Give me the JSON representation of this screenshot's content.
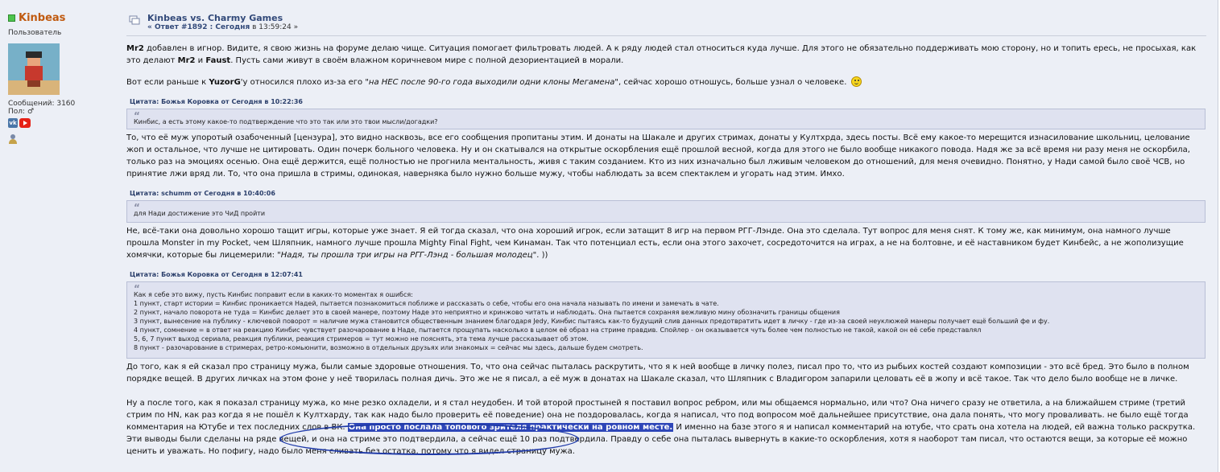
{
  "user": {
    "name": "Kinbeas",
    "title": "Пользователь",
    "posts_label": "Сообщений: 3160",
    "gender_label": "Пол:",
    "gender_symbol": "♂",
    "vk_label": "vk",
    "online_color": "#4ec44e"
  },
  "post": {
    "title": "Kinbeas vs. Charmy Games",
    "reply_prefix": "« Ответ #1892 : Сегодня",
    "reply_time": " в 13:59:24 »",
    "para1": [
      {
        "t": "Mr2",
        "b": true
      },
      {
        "t": " добавлен в игнор. Видите, я свою жизнь на форуме делаю чище. Ситуация помогает фильтровать людей. А к ряду людей стал относиться куда лучше. Для этого не обязательно поддерживать мою сторону, но и топить ересь, не просыхая, как это делают "
      },
      {
        "t": "Mr2",
        "b": true
      },
      {
        "t": " и "
      },
      {
        "t": "Faust",
        "b": true
      },
      {
        "t": ". Пусть сами живут в своём влажном коричневом мире с полной дезориентацией в морали."
      }
    ],
    "para2": [
      {
        "t": "Вот если раньше к "
      },
      {
        "t": "YuzorG",
        "b": true
      },
      {
        "t": "'у относился плохо из-за его \""
      },
      {
        "t": "на НЕС после 90-го года выходили одни клоны Мегамена",
        "i": true
      },
      {
        "t": "\", сейчас хорошо отношусь, больше узнал о человеке."
      }
    ],
    "quote1": {
      "head": "Цитата: Божья Коровка от Сегодня в 10:22:36",
      "lines": [
        "Кинбис, а есть этому какое-то подтверждение что это так или это твои мысли/догадки?"
      ]
    },
    "para3": "То, что её муж упоротый озабоченный [цензура], это видно насквозь, все его сообщения пропитаны этим. И донаты на Шакале и других стримах, донаты у Култхрда, здесь посты. Всё ему какое-то мерещится изнасилование школьниц, целование жоп и остальное, что лучше не цитировать. Один почерк больного человека. Ну и он скатывался на открытые оскорбления ещё прошлой весной, когда для этого не было вообще никакого повода. Надя же за всё время ни разу меня не оскорбила, только раз на эмоциях осенью. Она ещё держится, ещё полностью не прогнила ментальность, живя с таким созданием. Кто из них изначально был лживым человеком до отношений, для меня очевидно. Понятно, у Нади самой было своё ЧСВ, но принятие лжи вряд ли. То, что она пришла в стримы, одинокая, наверняка было нужно больше мужу, чтобы наблюдать за всем спектаклем и угорать над этим. Имхо.",
    "quote2": {
      "head": "Цитата: schumm от Сегодня в 10:40:06",
      "lines": [
        "для Нади достижение это ЧиД пройти"
      ]
    },
    "para4": [
      {
        "t": "Не, всё-таки она довольно хорошо тащит игры, которые уже знает. Я ей тогда сказал, что она хороший игрок, если затащит 8 игр на первом РГГ-Лэнде. Она это сделала. Тут вопрос для меня снят. К тому же, как минимум, она намного лучше прошла Monster in my Pocket, чем Шляпник, намного лучше прошла Mighty Final Fight, чем Кинаман. Так что потенциал есть, если она этого захочет, сосредоточится на играх, а не на болтовне, и её наставником будет Кинбейс, а не жополизущие хомячки, которые бы лицемерили: \""
      },
      {
        "t": "Надя, ты прошла три игры на РГГ-Лэнд - большая молодец",
        "i": true
      },
      {
        "t": "\". ))"
      }
    ],
    "quote3": {
      "head": "Цитата: Божья Коровка от Сегодня в 12:07:41",
      "lines": [
        "Как я себе это вижу, пусть Кинбис поправит если в каких-то моментах я ошибся:",
        "1 пункт, старт истории = Кинбис проникается Надей, пытается познакомиться поближе и рассказать о себе, чтобы его она начала называть по имени и замечать в чате.",
        "2 пункт, начало поворота не туда = Кинбис делает это в своей манере, поэтому Наде это неприятно и кринжово читать и наблюдать. Она пытается сохраняя вежливую мину обозначить границы общения",
        "3 пункт, вынесение на публику - ключевой поворот = наличие мужа становится общественным знанием благодаря Jedy, Кинбис пытаясь как-то будущий слив данных предотвратить идет в личку - где из-за своей неуклюжей манеры получает ещё больший фе и фу.",
        "4 пункт, сомнение = в ответ на реакцию Кинбис чувствует разочарование в Наде, пытается прощупать насколько в целом её образ на стриме правдив. Спойлер - он оказывается чуть более чем полностью не такой, какой он её себе представлял",
        "5, 6, 7 пункт выход сериала, реакция публики, реакция стримеров = тут можно не пояснять, эта тема лучше рассказывает об этом.",
        "8 пункт - разочарование в стримерах, ретро-комьюнити, возможно в отдельных друзьях или знакомых = сейчас мы здесь, дальше будем смотреть."
      ]
    },
    "para5": "До того, как я ей сказал про страницу мужа, были самые здоровые отношения. То, что она сейчас пыталась раскрутить, что я к ней вообще в личку полез, писал про то, что из рыбьих костей создают композиции - это всё бред. Это было в полном порядке вещей. В других личках на этом фоне у неё творилась полная дичь. Это же не я писал, а её муж в донатах на Шакале сказал, что Шляпник с Владигором запарили целовать её в жопу и всё такое. Так что дело было вообще не в личке.",
    "para6_before": "Ну а после того, как я показал страницу мужа, ко мне резко охладели, и я стал неудобен. И той второй простыней я поставил вопрос ребром, или мы общаемся нормально, или что? Она ничего сразу не ответила, а на ближайшем стриме (третий стрим по HN, как раз когда я не пошёл к Култхарду, так как надо было проверить её поведение) она не поздоровалась, когда я написал, что под вопросом моё дальнейшее присутствие, она дала понять, что могу проваливать. не было ещё тогда комментария на Ютубе и тех последних слов в ВК. ",
    "para6_highlight": "Она просто послала топового зрителя практически на ровном месте.",
    "para6_after": " И именно на базе этого я и написал комментарий на ютубе, что срать она хотела на людей, ей важна только раскрутка. Эти выводы были сделаны на ряде вещей, и она на стриме это подтвердила, а сейчас ещё 10 раз подтвердила. Правду о себе она пыталась вывернуть в какие-то оскорбления, хотя я наоборот там писал, что остаются вещи, за которые её можно ценить и уважать. Но пофигу, надо было меня сливать без остатка, потому что я видел страницу мужа.",
    "highlight_color": "#2e46b8"
  }
}
